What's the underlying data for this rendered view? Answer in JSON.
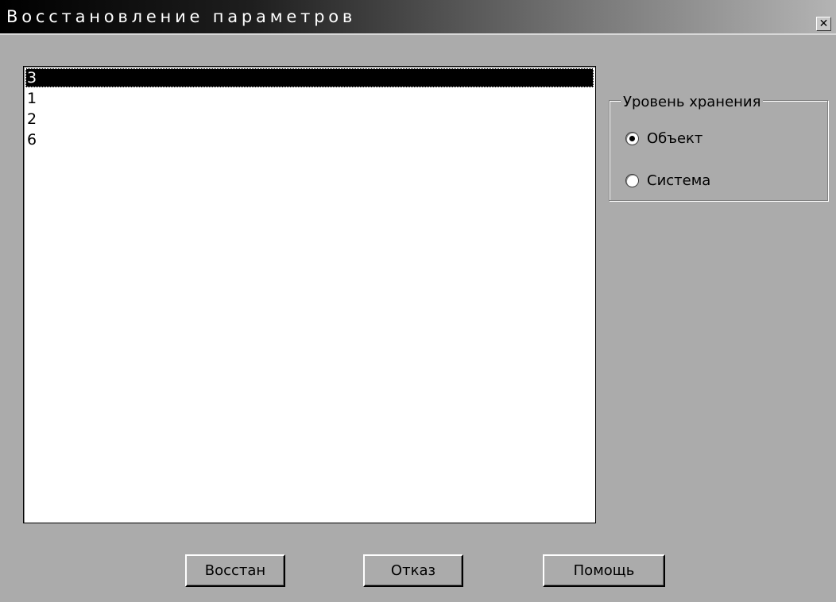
{
  "window": {
    "title": "Восстановление параметров",
    "close_label": "✕"
  },
  "list": {
    "items": [
      "3",
      "1",
      "2",
      "6"
    ],
    "selected_index": 0
  },
  "storage_level": {
    "legend": "Уровень хранения",
    "options": [
      {
        "label": "Объект",
        "checked": true
      },
      {
        "label": "Система",
        "checked": false
      }
    ]
  },
  "buttons": {
    "restore": "Восстан",
    "cancel": "Отказ",
    "help": "Помощь"
  }
}
